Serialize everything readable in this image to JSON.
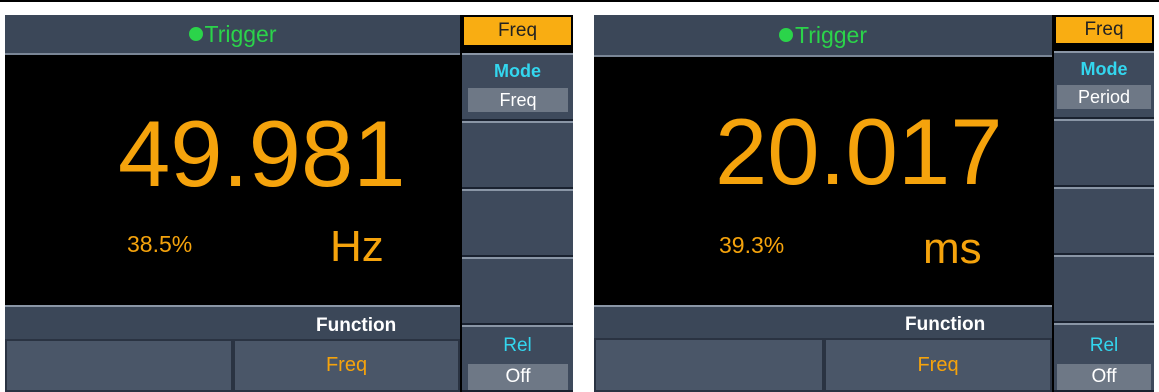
{
  "panels": [
    {
      "trigger_label": "Trigger",
      "value": "49.981",
      "percent": "38.5%",
      "unit": "Hz",
      "function_label": "Function",
      "function_buttons": [
        "",
        "Freq"
      ],
      "side": {
        "header": "Freq",
        "mode_title": "Mode",
        "mode_value": "Freq",
        "rel_title": "Rel",
        "rel_value": "Off"
      }
    },
    {
      "trigger_label": "Trigger",
      "value": "20.017",
      "percent": "39.3%",
      "unit": "ms",
      "function_label": "Function",
      "function_buttons": [
        "",
        "Freq"
      ],
      "side": {
        "header": "Freq",
        "mode_title": "Mode",
        "mode_value": "Period",
        "rel_title": "Rel",
        "rel_value": "Off"
      }
    }
  ],
  "colors": {
    "reading": "#f5a30c",
    "trigger": "#2bd44a",
    "softkey_title": "#33d6ee",
    "active_softkey": "#f9ad12"
  }
}
